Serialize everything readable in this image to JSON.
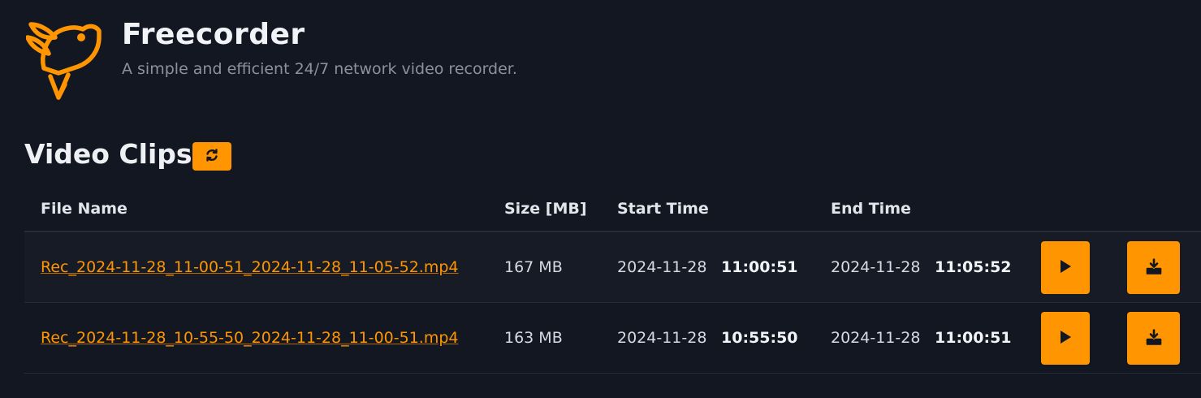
{
  "app": {
    "title": "Freecorder",
    "subtitle": "A simple and efficient 24/7 network video recorder."
  },
  "section": {
    "title": "Video Clips"
  },
  "table": {
    "headers": {
      "file_name": "File Name",
      "size": "Size [MB]",
      "start_time": "Start Time",
      "end_time": "End Time"
    },
    "rows": [
      {
        "file_name": "Rec_2024-11-28_11-00-51_2024-11-28_11-05-52.mp4",
        "size": "167 MB",
        "start_date": "2024-11-28",
        "start_time": "11:00:51",
        "end_date": "2024-11-28",
        "end_time": "11:05:52"
      },
      {
        "file_name": "Rec_2024-11-28_10-55-50_2024-11-28_11-00-51.mp4",
        "size": "163 MB",
        "start_date": "2024-11-28",
        "start_time": "10:55:50",
        "end_date": "2024-11-28",
        "end_time": "11:00:51"
      }
    ]
  },
  "icons": {
    "logo": "bird-logo-icon",
    "refresh": "refresh-icon",
    "play": "play-icon",
    "download": "download-icon"
  },
  "colors": {
    "background": "#121722",
    "accent": "#ff9500",
    "text": "#e6e8ec",
    "muted": "#8c929c"
  }
}
